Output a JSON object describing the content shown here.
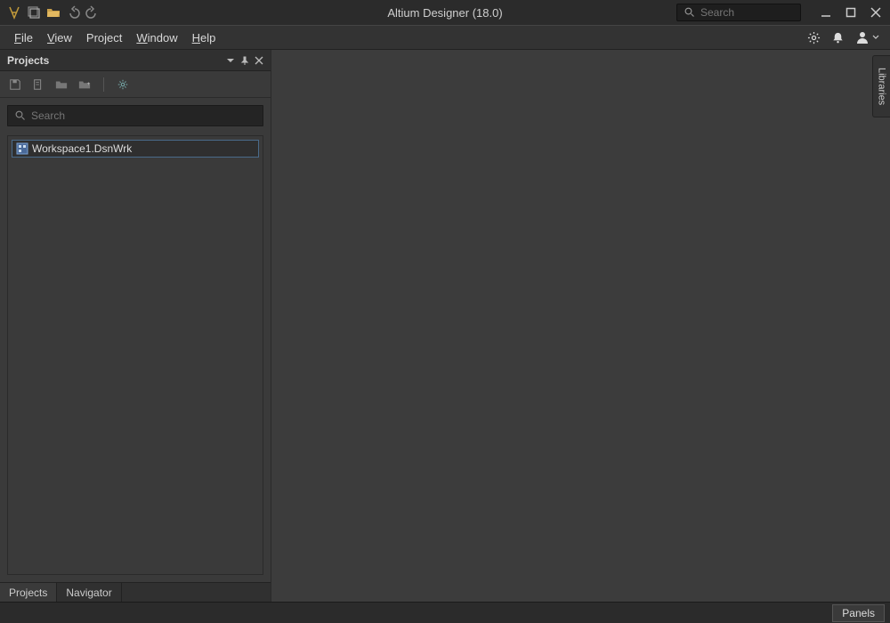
{
  "titlebar": {
    "title": "Altium Designer (18.0)",
    "search_placeholder": "Search"
  },
  "menubar": {
    "items": [
      {
        "label": "File",
        "accel": "F"
      },
      {
        "label": "View",
        "accel": "V"
      },
      {
        "label": "Project",
        "accel": ""
      },
      {
        "label": "Window",
        "accel": "W"
      },
      {
        "label": "Help",
        "accel": "H"
      }
    ]
  },
  "panel": {
    "title": "Projects",
    "search_placeholder": "Search",
    "tree": {
      "workspace": "Workspace1.DsnWrk"
    },
    "tabs": [
      {
        "label": "Projects",
        "active": true
      },
      {
        "label": "Navigator",
        "active": false
      }
    ]
  },
  "right_tab": {
    "label": "Libraries"
  },
  "statusbar": {
    "panels_button": "Panels"
  },
  "icons": {
    "app": "app-logo",
    "save": "save",
    "open": "folder-open",
    "undo": "undo",
    "redo": "redo",
    "search": "magnifier",
    "minimize": "minimize",
    "maximize": "maximize",
    "close": "close",
    "settings": "gear",
    "notifications": "bell",
    "user": "user",
    "dropdown": "chevron-down",
    "pin": "pin",
    "panel_close": "close-small",
    "panel_menu": "triangle-down"
  }
}
